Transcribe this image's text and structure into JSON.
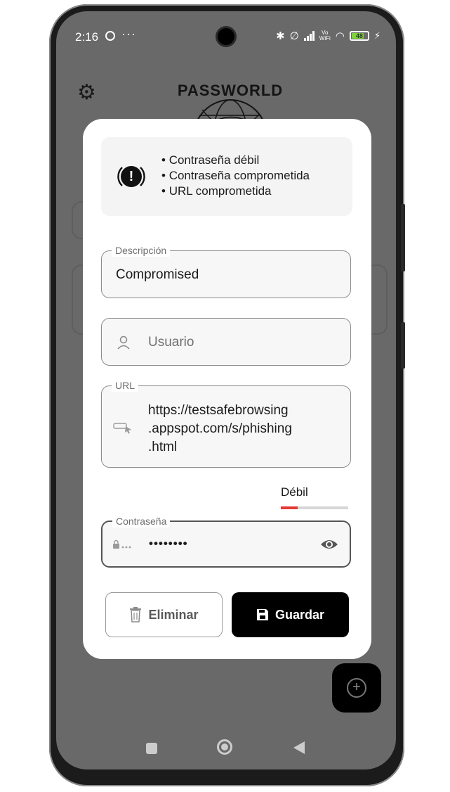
{
  "status_bar": {
    "time": "2:16",
    "dots": "···",
    "vowifi_top": "Vo",
    "vowifi_bottom": "WiFi",
    "battery": "48"
  },
  "app": {
    "logo_text": "PASSWORLD"
  },
  "dialog": {
    "warnings": [
      "Contraseña débil",
      "Contraseña comprometida",
      "URL comprometida"
    ],
    "description": {
      "label": "Descripción",
      "value": "Compromised"
    },
    "user": {
      "placeholder": "Usuario"
    },
    "url": {
      "label": "URL",
      "value_lines": [
        "https://testsafebrowsing",
        ".appspot.com/s/phishing",
        ".html"
      ]
    },
    "strength": {
      "label": "Débil",
      "level": 0.25,
      "color": "#e53935"
    },
    "password": {
      "label": "Contraseña",
      "value": "••••••••"
    },
    "delete_label": "Eliminar",
    "save_label": "Guardar"
  },
  "icons": {
    "settings": "gear-icon",
    "warning": "exclamation-icon",
    "user": "person-icon",
    "url": "link-cursor-icon",
    "password": "lock-dots-icon",
    "visibility": "eye-icon",
    "delete": "trash-icon",
    "save": "floppy-icon",
    "add": "plus-icon"
  }
}
